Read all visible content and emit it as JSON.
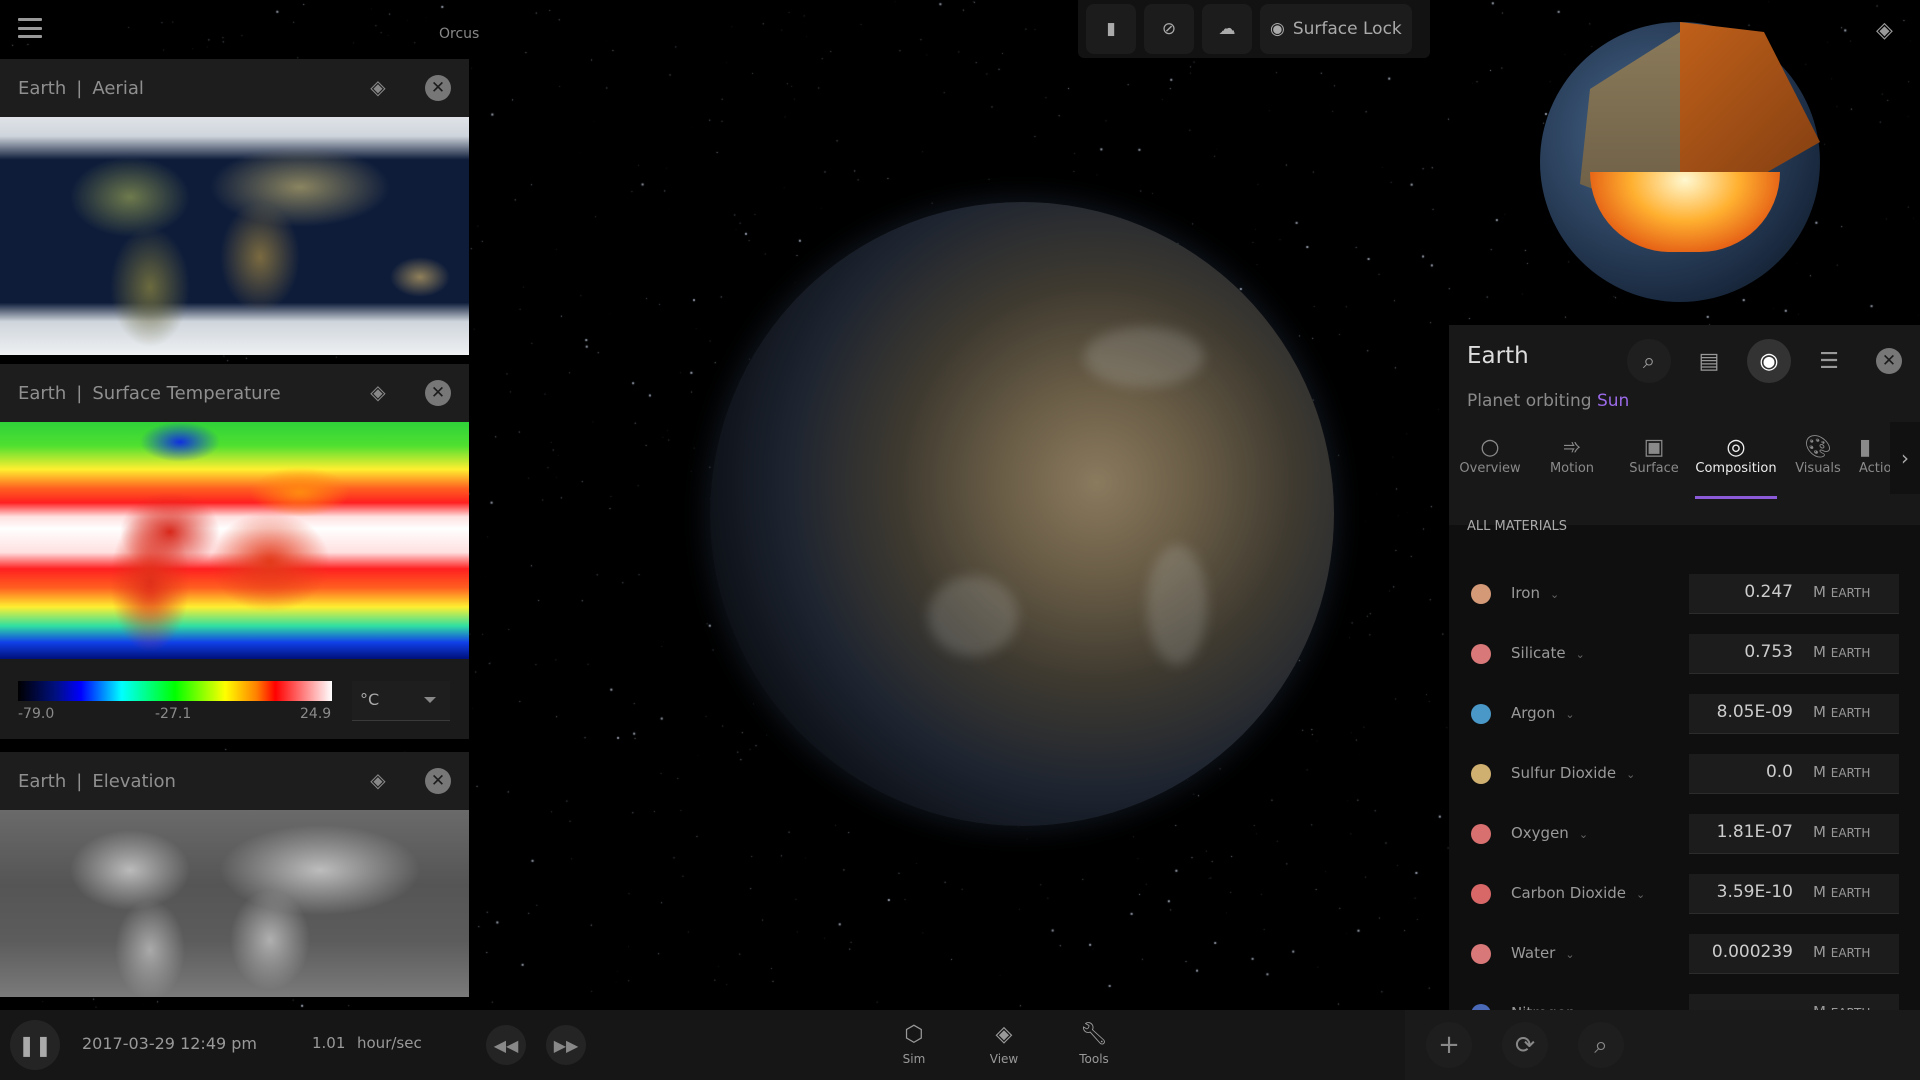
{
  "top": {
    "object_label": "Orcus",
    "surface_lock_label": "Surface Lock",
    "toolbar_icons": [
      "flashlight-icon",
      "no-atmosphere-icon",
      "no-clouds-icon",
      "surface-lock-icon"
    ]
  },
  "layers": [
    {
      "body": "Earth",
      "layer": "Aerial"
    },
    {
      "body": "Earth",
      "layer": "Surface Temperature",
      "legend": {
        "min": "-79.0",
        "mid": "-27.1",
        "max": "24.9",
        "unit": "°C"
      }
    },
    {
      "body": "Earth",
      "layer": "Elevation"
    }
  ],
  "panel": {
    "title": "Earth",
    "subtitle_prefix": "Planet orbiting",
    "subtitle_link": "Sun",
    "accent": "#8a5ad8",
    "tabs": [
      {
        "label": "Overview"
      },
      {
        "label": "Motion"
      },
      {
        "label": "Surface"
      },
      {
        "label": "Composition",
        "active": true
      },
      {
        "label": "Visuals"
      },
      {
        "label": "Actions"
      }
    ],
    "section": "ALL MATERIALS",
    "unit_m": "M",
    "unit_earth": "EARTH",
    "materials": [
      {
        "name": "Iron",
        "value": "0.247",
        "color": "#d49a78"
      },
      {
        "name": "Silicate",
        "value": "0.753",
        "color": "#d87878"
      },
      {
        "name": "Argon",
        "value": "8.05E-09",
        "color": "#4a98c8"
      },
      {
        "name": "Sulfur Dioxide",
        "value": "0.0",
        "color": "#d0b070"
      },
      {
        "name": "Oxygen",
        "value": "1.81E-07",
        "color": "#d87070"
      },
      {
        "name": "Carbon Dioxide",
        "value": "3.59E-10",
        "color": "#d86868"
      },
      {
        "name": "Water",
        "value": "0.000239",
        "color": "#d87878"
      },
      {
        "name": "Nitrogen",
        "value": "",
        "color": "#4a6ab8"
      }
    ]
  },
  "bottom": {
    "datetime": "2017-03-29 12:49 pm",
    "rate": "1.01",
    "rate_unit": "hour/sec",
    "nav": [
      {
        "label": "Sim"
      },
      {
        "label": "View"
      },
      {
        "label": "Tools"
      }
    ]
  }
}
